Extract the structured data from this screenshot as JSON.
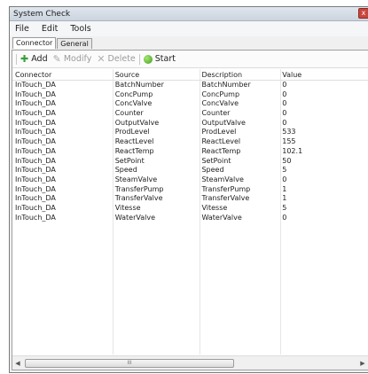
{
  "window": {
    "title": "System Check",
    "close_glyph": "x"
  },
  "menu": {
    "items": [
      "File",
      "Edit",
      "Tools"
    ]
  },
  "tabs": [
    {
      "label": "Connector",
      "active": true
    },
    {
      "label": "General",
      "active": false
    }
  ],
  "toolbar": {
    "add_label": "Add",
    "modify_label": "Modify",
    "delete_label": "Delete",
    "start_label": "Start"
  },
  "table": {
    "columns": [
      "Connector",
      "Source",
      "Description",
      "Value"
    ],
    "rows": [
      [
        "InTouch_DA",
        "BatchNumber",
        "BatchNumber",
        "0"
      ],
      [
        "InTouch_DA",
        "ConcPump",
        "ConcPump",
        "0"
      ],
      [
        "InTouch_DA",
        "ConcValve",
        "ConcValve",
        "0"
      ],
      [
        "InTouch_DA",
        "Counter",
        "Counter",
        "0"
      ],
      [
        "InTouch_DA",
        "OutputValve",
        "OutputValve",
        "0"
      ],
      [
        "InTouch_DA",
        "ProdLevel",
        "ProdLevel",
        "533"
      ],
      [
        "InTouch_DA",
        "ReactLevel",
        "ReactLevel",
        "155"
      ],
      [
        "InTouch_DA",
        "ReactTemp",
        "ReactTemp",
        "102.1"
      ],
      [
        "InTouch_DA",
        "SetPoint",
        "SetPoint",
        "50"
      ],
      [
        "InTouch_DA",
        "Speed",
        "Speed",
        "5"
      ],
      [
        "InTouch_DA",
        "SteamValve",
        "SteamValve",
        "0"
      ],
      [
        "InTouch_DA",
        "TransferPump",
        "TransferPump",
        "1"
      ],
      [
        "InTouch_DA",
        "TransferValve",
        "TransferValve",
        "1"
      ],
      [
        "InTouch_DA",
        "Vitesse",
        "Vitesse",
        "5"
      ],
      [
        "InTouch_DA",
        "WaterValve",
        "WaterValve",
        "0"
      ]
    ]
  },
  "scrollbar": {
    "left_arrow": "◀",
    "right_arrow": "▶",
    "thumb_grip": "III"
  },
  "icons": {
    "add": "add-icon",
    "modify": "pencil-icon",
    "delete": "delete-icon",
    "start": "start-icon"
  }
}
